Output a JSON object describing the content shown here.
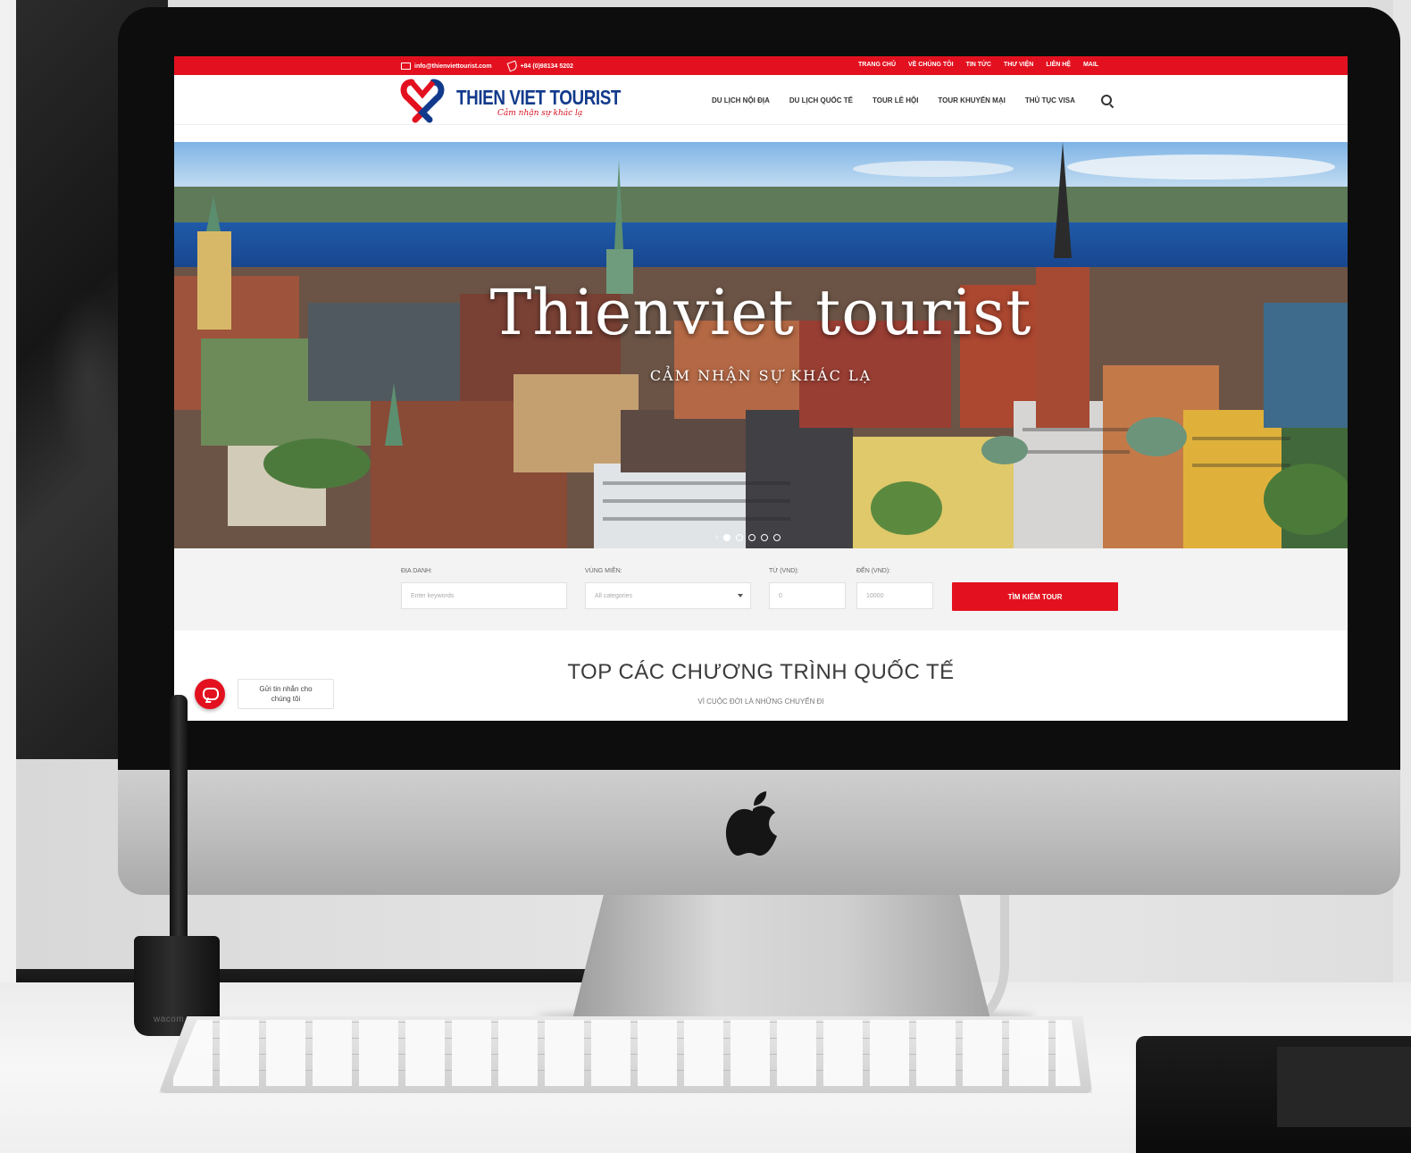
{
  "topbar": {
    "email": "info@thienviettourist.com",
    "phone": "+84 (0)98134 5202",
    "links": [
      "TRANG CHỦ",
      "VỀ CHÚNG TÔI",
      "TIN TỨC",
      "THƯ VIỆN",
      "LIÊN HỆ",
      "MAIL"
    ]
  },
  "brand": {
    "name": "THIEN VIET TOURIST",
    "slogan": "Cảm nhận sự khác lạ"
  },
  "nav": {
    "items": [
      "DU LỊCH NỘI ĐỊA",
      "DU LỊCH QUỐC TẾ",
      "TOUR LỄ HỘI",
      "TOUR KHUYẾN MẠI",
      "THỦ TỤC VISA"
    ]
  },
  "hero": {
    "title": "Thienviet tourist",
    "subtitle": "CẢM NHẬN SỰ KHÁC LẠ"
  },
  "search": {
    "labels": [
      "ĐỊA DANH:",
      "VÙNG MIỀN:",
      "TỪ (VND):",
      "ĐẾN (VND):"
    ],
    "keyword_placeholder": "Enter keywords",
    "category_value": "All categories",
    "from_value": "0",
    "to_value": "10000",
    "button": "TÌM KIẾM TOUR"
  },
  "section": {
    "title": "TOP CÁC CHƯƠNG TRÌNH QUỐC TẾ",
    "subtitle": "VÌ CUỘC ĐỜI LÀ NHỮNG CHUYẾN ĐI"
  },
  "chat": {
    "line1": "Gửi tin nhắn cho",
    "line2": "chúng tôi"
  },
  "desk": {
    "pen_cup_label": "wacom"
  },
  "colors": {
    "brand_red": "#e3111f",
    "brand_blue": "#123a8c"
  }
}
